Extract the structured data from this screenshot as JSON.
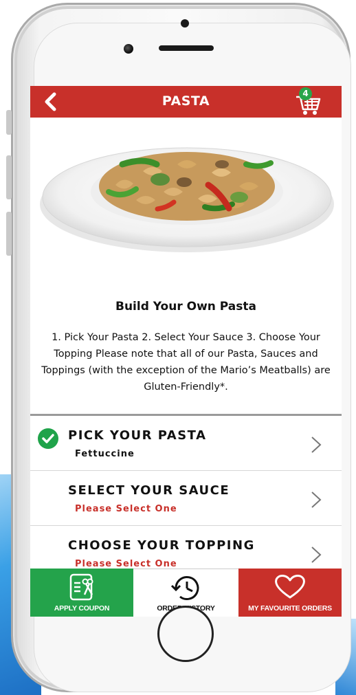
{
  "header": {
    "title": "PASTA",
    "cart_count": "4"
  },
  "product": {
    "title": "Build Your Own Pasta",
    "description": "1. Pick Your Pasta 2. Select Your Sauce 3. Choose Your Topping Please note that all of our Pasta, Sauces and Toppings (with the exception of the Mario’s Meatballs) are Gluten-Friendly*."
  },
  "options": [
    {
      "title": "PICK YOUR PASTA",
      "subtitle": "Fettuccine",
      "completed": true
    },
    {
      "title": "SELECT YOUR SAUCE",
      "subtitle": "Please Select One",
      "completed": false
    },
    {
      "title": "CHOOSE YOUR TOPPING",
      "subtitle": "Please Select One",
      "completed": false
    }
  ],
  "bottom_nav": {
    "coupon_label": "APPLY COUPON",
    "history_label": "ORDER HISTORY",
    "favourites_label": "MY FAVOURITE ORDERS"
  },
  "colors": {
    "brand_red": "#c8302a",
    "success_green": "#24a34b"
  },
  "icons": {
    "back": "chevron-left-icon",
    "cart": "shopping-cart-icon",
    "check": "check-icon",
    "coupon": "coupon-scissors-icon",
    "history": "clock-history-icon",
    "favourites": "heart-icon"
  }
}
